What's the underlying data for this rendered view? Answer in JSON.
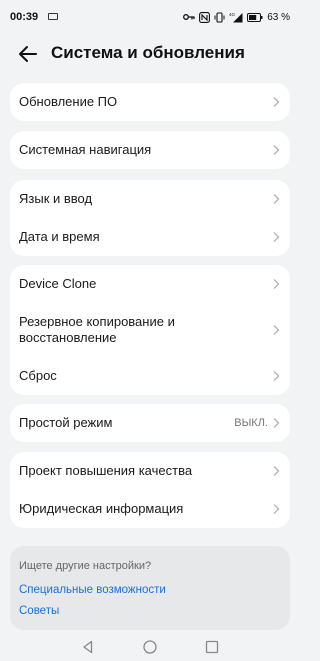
{
  "status_bar": {
    "time": "00:39",
    "battery": "63 %",
    "network": "4G"
  },
  "header": {
    "title": "Система и обновления"
  },
  "groups": [
    {
      "items": [
        {
          "label": "Обновление ПО"
        }
      ]
    },
    {
      "items": [
        {
          "label": "Системная навигация"
        }
      ]
    },
    {
      "items": [
        {
          "label": "Язык и ввод"
        },
        {
          "label": "Дата и время"
        }
      ]
    },
    {
      "items": [
        {
          "label": "Device Clone"
        },
        {
          "label": "Резервное копирование и восстановление"
        },
        {
          "label": "Сброс"
        }
      ]
    },
    {
      "items": [
        {
          "label": "Простой режим",
          "value": "ВЫКЛ."
        }
      ]
    },
    {
      "items": [
        {
          "label": "Проект повышения качества"
        },
        {
          "label": "Юридическая информация"
        }
      ]
    }
  ],
  "help": {
    "title": "Ищете другие настройки?",
    "links": [
      "Специальные возможности",
      "Советы"
    ]
  },
  "icons": [
    "back-arrow-icon",
    "chevron-right-icon",
    "nav-back-icon",
    "nav-home-icon",
    "nav-recents-icon"
  ],
  "colors": {
    "background": "#f1f3f5",
    "card": "#ffffff",
    "link": "#1a6fd8",
    "help_card": "#e6e8ea"
  }
}
